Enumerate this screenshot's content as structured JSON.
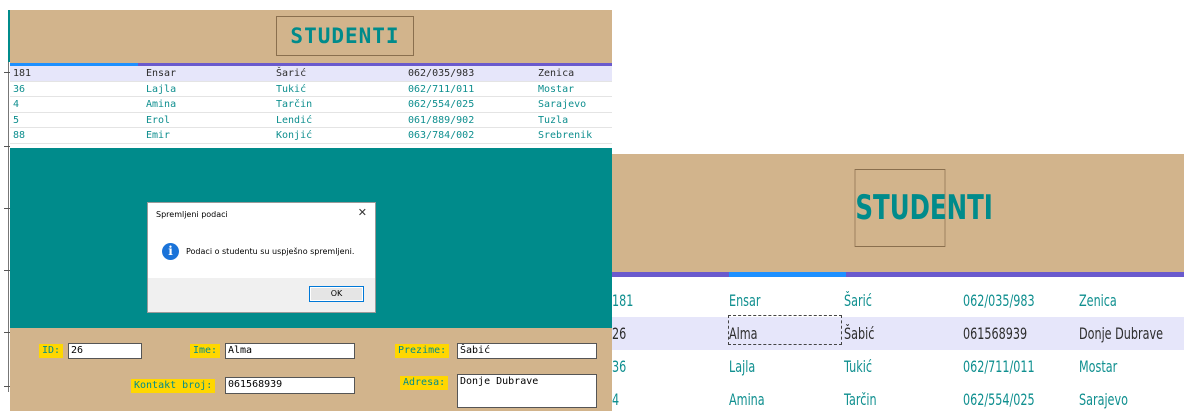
{
  "left": {
    "title": "STUDENTI",
    "rows": [
      [
        "181",
        "Ensar",
        "Šarić",
        "062/035/983",
        "Zenica"
      ],
      [
        "36",
        "Lajla",
        "Tukić",
        "062/711/011",
        "Mostar"
      ],
      [
        "4",
        "Amina",
        "Tarčin",
        "062/554/025",
        "Sarajevo"
      ],
      [
        "5",
        "Erol",
        "Lendić",
        "061/889/902",
        "Tuzla"
      ],
      [
        "88",
        "Emir",
        "Konjić",
        "063/784/002",
        "Srebrenik"
      ]
    ],
    "dialog": {
      "title": "Spremljeni podaci",
      "close": "✕",
      "info_icon": "i",
      "message": "Podaci o studentu su uspješno spremljeni.",
      "ok": "OK"
    },
    "form": {
      "id_label": "ID:",
      "id_value": "26",
      "ime_label": "Ime:",
      "ime_value": "Alma",
      "prezime_label": "Prezime:",
      "prezime_value": "Šabić",
      "kontakt_label": "Kontakt broj:",
      "kontakt_value": "061568939",
      "adresa_label": "Adresa:",
      "adresa_value": "Donje Dubrave"
    }
  },
  "right": {
    "title": "STUDENTI",
    "rows": [
      [
        "181",
        "Ensar",
        "Šarić",
        "062/035/983",
        "Zenica"
      ],
      [
        "26",
        "Alma",
        "Šabić",
        "061568939",
        "Donje Dubrave"
      ],
      [
        "36",
        "Lajla",
        "Tukić",
        "062/711/011",
        "Mostar"
      ],
      [
        "4",
        "Amina",
        "Tarčin",
        "062/554/025",
        "Sarajevo"
      ]
    ]
  },
  "colors": {
    "header_bg": "#d2b48c",
    "teal": "#008b8b",
    "label_bg": "#ffd700",
    "selected_row": "#e6e6fa",
    "tab_bar": "#6a5acd",
    "tab_active": "#1e90ff"
  }
}
